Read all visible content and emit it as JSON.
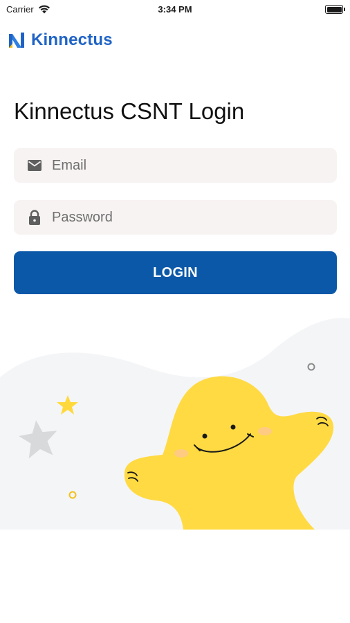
{
  "status_bar": {
    "carrier": "Carrier",
    "time": "3:34 PM"
  },
  "brand": {
    "name": "Kinnectus",
    "color": "#1f63c6"
  },
  "login": {
    "title": "Kinnectus CSNT Login",
    "email_placeholder": "Email",
    "password_placeholder": "Password",
    "button_label": "LOGIN",
    "button_color": "#0b58a8"
  },
  "icons": {
    "email": "envelope-icon",
    "password": "lock-icon",
    "wifi": "wifi-icon",
    "battery": "battery-icon",
    "logo": "kinnectus-logo-icon"
  }
}
